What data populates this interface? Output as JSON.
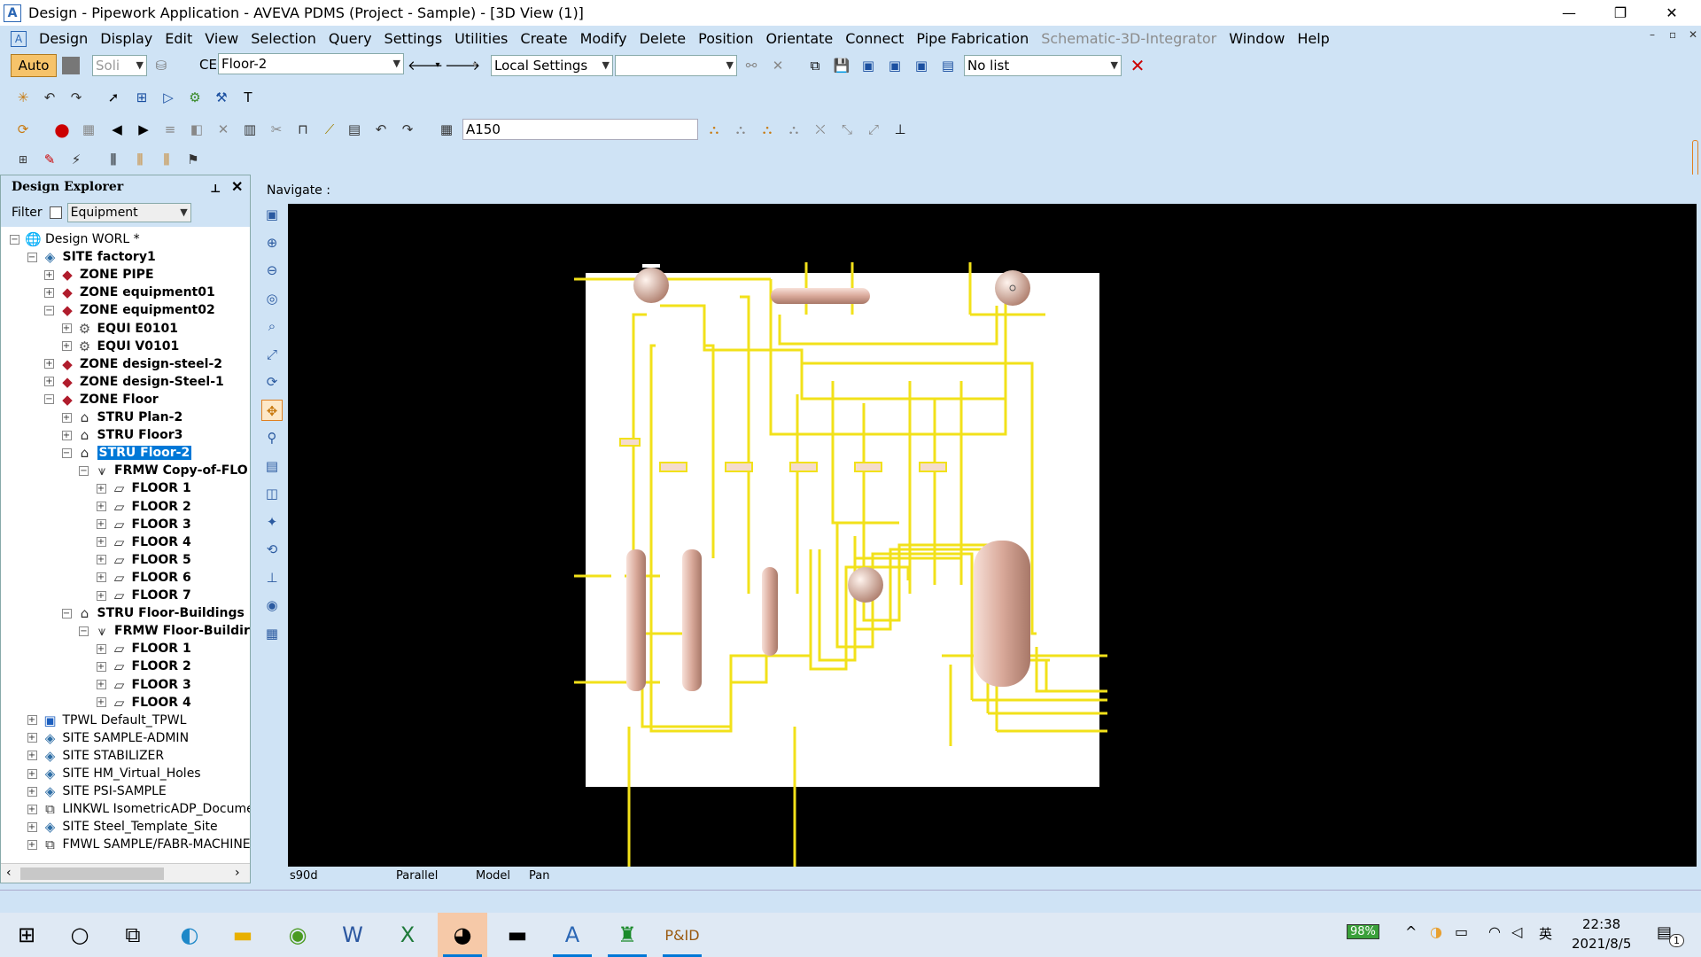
{
  "window": {
    "title": "Design - Pipework Application - AVEVA PDMS (Project - Sample) - [3D View (1)]",
    "app_icon": "A",
    "minimize": "—",
    "restore": "❐",
    "close": "✕"
  },
  "menu": [
    "Design",
    "Display",
    "Edit",
    "View",
    "Selection",
    "Query",
    "Settings",
    "Utilities",
    "Create",
    "Modify",
    "Delete",
    "Position",
    "Orientate",
    "Connect",
    "Pipe Fabrication",
    "Schematic-3D-Integrator",
    "Window",
    "Help"
  ],
  "toolbar1": {
    "auto_label": "Auto",
    "solid_label": "Soli",
    "ce_label": "CE",
    "ce_value": "Floor-2",
    "settings_value": "Local Settings",
    "empty_combo": "",
    "list_value": "No list"
  },
  "toolbar3": {
    "spec_value": "A150"
  },
  "explorer": {
    "title": "Design Explorer",
    "pin": "📌",
    "close": "✕",
    "filter_label": "Filter",
    "filter_value": "Equipment",
    "nodes": [
      {
        "label": "Design WORL *",
        "level": 0,
        "exp": "−",
        "icon": "globe"
      },
      {
        "label": "SITE factory1",
        "level": 1,
        "exp": "−",
        "icon": "site"
      },
      {
        "label": "ZONE PIPE",
        "level": 2,
        "exp": "+",
        "icon": "zone"
      },
      {
        "label": "ZONE equipment01",
        "level": 2,
        "exp": "+",
        "icon": "zone"
      },
      {
        "label": "ZONE equipment02",
        "level": 2,
        "exp": "−",
        "icon": "zone"
      },
      {
        "label": "EQUI E0101",
        "level": 3,
        "exp": "+",
        "icon": "equi"
      },
      {
        "label": "EQUI V0101",
        "level": 3,
        "exp": "+",
        "icon": "equi"
      },
      {
        "label": "ZONE design-steel-2",
        "level": 2,
        "exp": "+",
        "icon": "zone"
      },
      {
        "label": "ZONE design-Steel-1",
        "level": 2,
        "exp": "+",
        "icon": "zone"
      },
      {
        "label": "ZONE Floor",
        "level": 2,
        "exp": "−",
        "icon": "zone"
      },
      {
        "label": "STRU Plan-2",
        "level": 3,
        "exp": "+",
        "icon": "stru"
      },
      {
        "label": "STRU Floor3",
        "level": 3,
        "exp": "+",
        "icon": "stru"
      },
      {
        "label": "STRU Floor-2",
        "level": 3,
        "exp": "−",
        "icon": "stru",
        "selected": true
      },
      {
        "label": "FRMW Copy-of-FLO",
        "level": 4,
        "exp": "−",
        "icon": "frmw"
      },
      {
        "label": "FLOOR 1",
        "level": 5,
        "exp": "+",
        "icon": "floor"
      },
      {
        "label": "FLOOR 2",
        "level": 5,
        "exp": "+",
        "icon": "floor"
      },
      {
        "label": "FLOOR 3",
        "level": 5,
        "exp": "+",
        "icon": "floor"
      },
      {
        "label": "FLOOR 4",
        "level": 5,
        "exp": "+",
        "icon": "floor"
      },
      {
        "label": "FLOOR 5",
        "level": 5,
        "exp": "+",
        "icon": "floor"
      },
      {
        "label": "FLOOR 6",
        "level": 5,
        "exp": "+",
        "icon": "floor"
      },
      {
        "label": "FLOOR 7",
        "level": 5,
        "exp": "+",
        "icon": "floor"
      },
      {
        "label": "STRU Floor-Buildings",
        "level": 3,
        "exp": "−",
        "icon": "stru"
      },
      {
        "label": "FRMW Floor-Buildir",
        "level": 4,
        "exp": "−",
        "icon": "frmw"
      },
      {
        "label": "FLOOR 1",
        "level": 5,
        "exp": "+",
        "icon": "floor"
      },
      {
        "label": "FLOOR 2",
        "level": 5,
        "exp": "+",
        "icon": "floor"
      },
      {
        "label": "FLOOR 3",
        "level": 5,
        "exp": "+",
        "icon": "floor"
      },
      {
        "label": "FLOOR 4",
        "level": 5,
        "exp": "+",
        "icon": "floor"
      },
      {
        "label": "TPWL Default_TPWL",
        "level": 1,
        "exp": "+",
        "icon": "tpwl"
      },
      {
        "label": "SITE SAMPLE-ADMIN",
        "level": 1,
        "exp": "+",
        "icon": "site"
      },
      {
        "label": "SITE STABILIZER",
        "level": 1,
        "exp": "+",
        "icon": "site"
      },
      {
        "label": "SITE HM_Virtual_Holes",
        "level": 1,
        "exp": "+",
        "icon": "site"
      },
      {
        "label": "SITE PSI-SAMPLE",
        "level": 1,
        "exp": "+",
        "icon": "site"
      },
      {
        "label": "LINKWL IsometricADP_Docume",
        "level": 1,
        "exp": "+",
        "icon": "link"
      },
      {
        "label": "SITE Steel_Template_Site",
        "level": 1,
        "exp": "+",
        "icon": "site"
      },
      {
        "label": "FMWL SAMPLE/FABR-MACHINE",
        "level": 1,
        "exp": "+",
        "icon": "link"
      }
    ]
  },
  "view": {
    "navigate_label": "Navigate :",
    "status": [
      "s90d",
      "Parallel",
      "Model",
      "Pan"
    ]
  },
  "taskbar": {
    "battery": "98%",
    "ime": "英",
    "time": "22:38",
    "date": "2021/8/5",
    "notification_count": "1"
  },
  "colors": {
    "pipe": "#f2e11a",
    "equipment": "#e8c5b8",
    "background3d": "#000000",
    "floor": "#ffffff"
  }
}
